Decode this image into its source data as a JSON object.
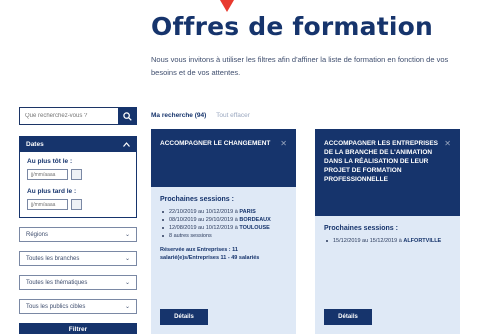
{
  "header": {
    "title": "Offres de formation",
    "intro": "Nous vous invitons à utiliser les filtres afin d'affiner la liste de formation en fonction de vos besoins et de vos attentes."
  },
  "sidebar": {
    "search_placeholder": "Que recherchez-vous ?",
    "dates": {
      "heading": "Dates",
      "from_label": "Au plus tôt le :",
      "to_label": "Au plus tard le :",
      "date_placeholder": "jj/mm/aaaa"
    },
    "selects": [
      "Régions",
      "Toutes les branches",
      "Toutes les thématiques",
      "Tous les publics cibles"
    ],
    "filter_label": "Filtrer"
  },
  "results": {
    "count_label": "Ma recherche (94)",
    "reset_label": "Tout effacer"
  },
  "cards": [
    {
      "title": "Accompagner le changement",
      "sessions_title": "Prochaines sessions :",
      "sessions": [
        {
          "dates": "22/10/2019 au 10/12/2019 à ",
          "city": "PARIS"
        },
        {
          "dates": "08/10/2019 au 29/10/2019 à ",
          "city": "BORDEAUX"
        },
        {
          "dates": "12/08/2019 au 10/12/2019 à ",
          "city": "TOULOUSE"
        },
        {
          "dates": "8 autres sessions",
          "city": ""
        }
      ],
      "public": "Réservée aux Entreprises : 11 salarié(e)s/Entreprises 11 - 49 salariés",
      "details_label": "Détails"
    },
    {
      "title": "Accompagner les entreprises de la branche de l'animation dans la réalisation de leur projet de formation professionnelle",
      "sessions_title": "Prochaines sessions :",
      "sessions": [
        {
          "dates": "15/12/2019 au 15/12/2019 à ",
          "city": "ALFORTVILLE"
        }
      ],
      "details_label": "Détails"
    }
  ],
  "colors": {
    "primary": "#16346c",
    "card_bg": "#dfe9f6",
    "accent_arrow": "#e8392e"
  }
}
